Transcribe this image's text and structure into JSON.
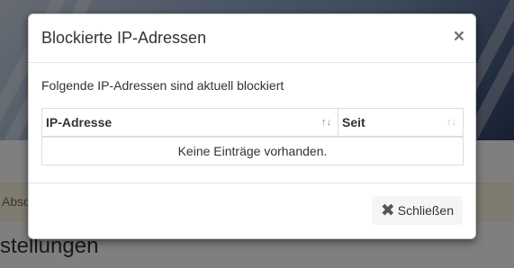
{
  "background": {
    "alert_text": "Abso",
    "heading": "stellungen"
  },
  "modal": {
    "title": "Blockierte IP-Adressen",
    "close_symbol": "×",
    "intro": "Folgende IP-Adressen sind aktuell blockiert",
    "table": {
      "columns": [
        "IP-Adresse",
        "Seit"
      ],
      "sort_symbol": "↑↓",
      "empty_message": "Keine Einträge vorhanden."
    },
    "footer": {
      "close_icon": "times-icon",
      "close_label": "Schließen"
    }
  },
  "colors": {
    "overlay": "#000000",
    "alert_bg": "#fcf8e3",
    "alert_text": "#8a6d3b",
    "button_bg": "#f5f5f5"
  }
}
